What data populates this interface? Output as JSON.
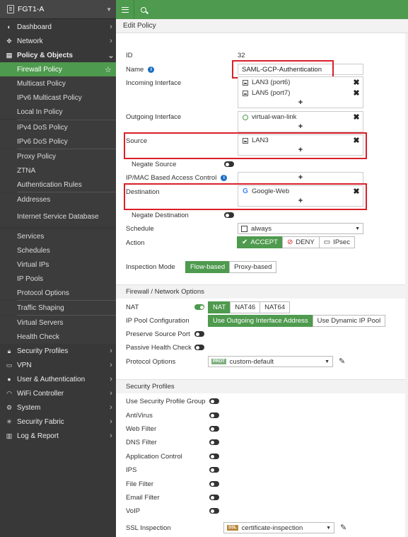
{
  "device": {
    "name": "FGT1-A"
  },
  "nav": {
    "dashboard": "Dashboard",
    "network": "Network",
    "policy_objects": "Policy & Objects",
    "policy_items": [
      "Firewall Policy",
      "Multicast Policy",
      "IPv6 Multicast Policy",
      "Local In Policy",
      "IPv4 DoS Policy",
      "IPv6 DoS Policy",
      "Proxy Policy",
      "ZTNA",
      "Authentication Rules",
      "Addresses",
      "Internet Service Database",
      "Services",
      "Schedules",
      "Virtual IPs",
      "IP Pools",
      "Protocol Options",
      "Traffic Shaping",
      "Virtual Servers",
      "Health Check"
    ],
    "security_profiles": "Security Profiles",
    "vpn": "VPN",
    "user_auth": "User & Authentication",
    "wifi": "WiFi Controller",
    "system": "System",
    "security_fabric": "Security Fabric",
    "log_report": "Log & Report"
  },
  "breadcrumb": "Edit Policy",
  "form": {
    "id_label": "ID",
    "id_value": "32",
    "name_label": "Name",
    "name_value": "SAML-GCP-Authentication",
    "incoming_label": "Incoming Interface",
    "incoming": [
      "LAN3 (port6)",
      "LAN5 (port7)"
    ],
    "outgoing_label": "Outgoing Interface",
    "outgoing": [
      "virtual-wan-link"
    ],
    "source_label": "Source",
    "source": [
      "LAN3"
    ],
    "negate_source_label": "Negate Source",
    "ipmac_label": "IP/MAC Based Access Control",
    "destination_label": "Destination",
    "destination": [
      "Google-Web"
    ],
    "negate_destination_label": "Negate Destination",
    "schedule_label": "Schedule",
    "schedule_value": "always",
    "action_label": "Action",
    "action_accept": "ACCEPT",
    "action_deny": "DENY",
    "action_ipsec": "IPsec",
    "inspection_label": "Inspection Mode",
    "inspection_flow": "Flow-based",
    "inspection_proxy": "Proxy-based",
    "plus": "+",
    "remove": "✖"
  },
  "fw_options": {
    "header": "Firewall / Network Options",
    "nat_label": "NAT",
    "nat_opts": [
      "NAT",
      "NAT46",
      "NAT64"
    ],
    "ippool_label": "IP Pool Configuration",
    "ippool_outgoing": "Use Outgoing Interface Address",
    "ippool_dynamic": "Use Dynamic IP Pool",
    "preserve_label": "Preserve Source Port",
    "passive_label": "Passive Health Check",
    "proto_label": "Protocol Options",
    "proto_badge": "PROT",
    "proto_value": "custom-default"
  },
  "sec_profiles": {
    "header": "Security Profiles",
    "group_label": "Use Security Profile Group",
    "items": [
      "AntiVirus",
      "Web Filter",
      "DNS Filter",
      "Application Control",
      "IPS",
      "File Filter",
      "Email Filter",
      "VoIP"
    ],
    "ssl_label": "SSL Inspection",
    "ssl_badge": "SSL",
    "ssl_value": "certificate-inspection"
  },
  "colors": {
    "accent": "#4e9a4e",
    "highlight": "#d9202a",
    "sidebar": "#383838"
  }
}
